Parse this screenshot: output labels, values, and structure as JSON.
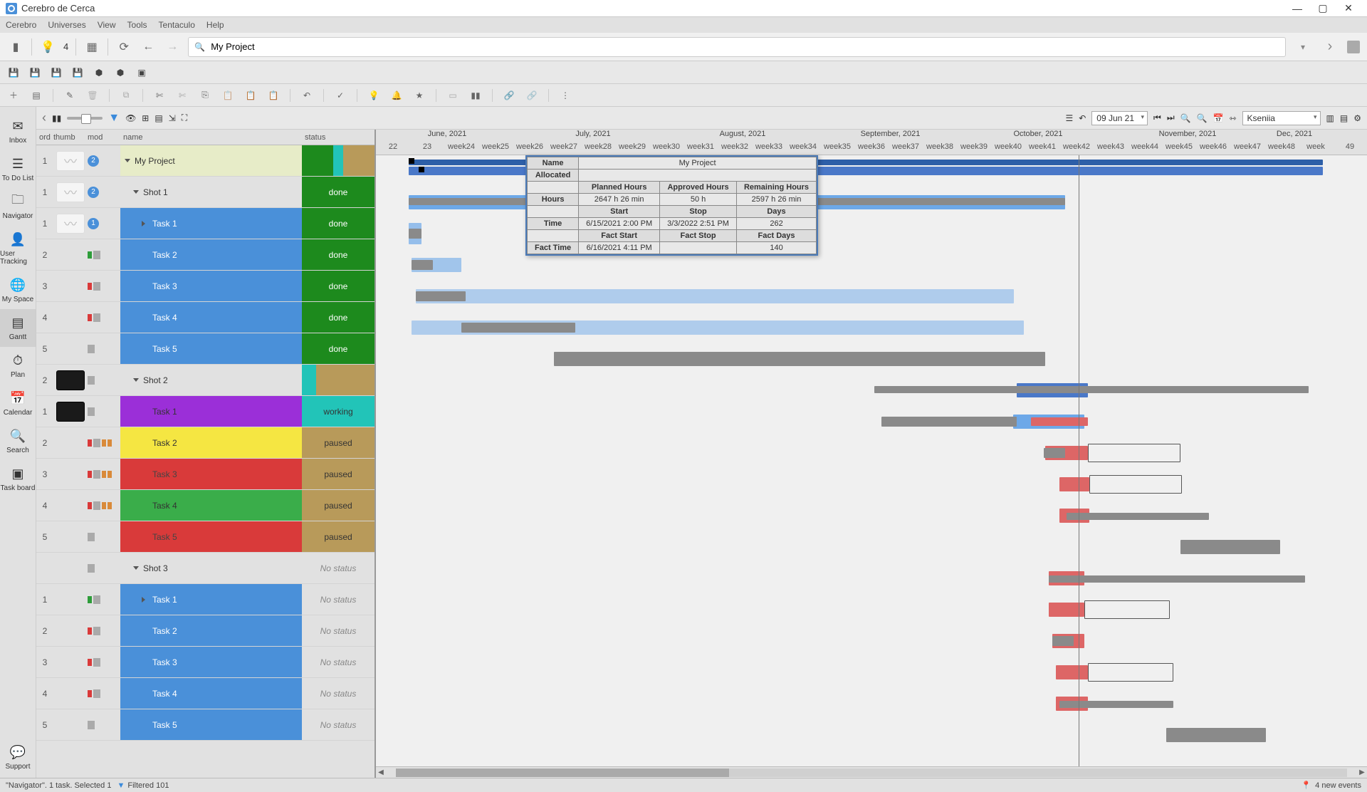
{
  "app": {
    "title": "Cerebro de Cerca"
  },
  "menus": [
    "Cerebro",
    "Universes",
    "View",
    "Tools",
    "Tentaculo",
    "Help"
  ],
  "search": {
    "value": "My Project",
    "lightbulb_count": "4"
  },
  "sidebar": [
    {
      "label": "Inbox"
    },
    {
      "label": "To Do List"
    },
    {
      "label": "Navigator"
    },
    {
      "label": "User Tracking"
    },
    {
      "label": "My Space"
    },
    {
      "label": "Gantt"
    },
    {
      "label": "Plan"
    },
    {
      "label": "Calendar"
    },
    {
      "label": "Search"
    },
    {
      "label": "Task board"
    }
  ],
  "support_label": "Support",
  "gantt_toolbar": {
    "date": "09 Jun 21",
    "user": "Kseniia"
  },
  "table_headers": {
    "ord": "ord",
    "thumb": "thumb",
    "mod": "mod",
    "name": "name",
    "status": "status"
  },
  "tasks": [
    {
      "ord": "1",
      "thumb": "leaf",
      "badge": "2",
      "name": "My Project",
      "level": 0,
      "nameClass": "project",
      "statusClass": "project",
      "statusText": ""
    },
    {
      "ord": "1",
      "thumb": "leaf",
      "badge": "2",
      "name": "Shot 1",
      "level": 1,
      "nameClass": "",
      "statusText": "done",
      "statusClass": "done"
    },
    {
      "ord": "1",
      "thumb": "leaf",
      "badge": "1",
      "mod": "blue",
      "name": "Task 1",
      "level": 2,
      "nameClass": "blue",
      "statusText": "done",
      "statusClass": "done"
    },
    {
      "ord": "2",
      "thumb": "",
      "mod": "green-grey",
      "name": "Task 2",
      "level": 2,
      "nameClass": "blue",
      "statusText": "done",
      "statusClass": "done"
    },
    {
      "ord": "3",
      "thumb": "",
      "mod": "red-grey",
      "name": "Task 3",
      "level": 2,
      "nameClass": "blue",
      "statusText": "done",
      "statusClass": "done"
    },
    {
      "ord": "4",
      "thumb": "",
      "mod": "red-grey",
      "name": "Task 4",
      "level": 2,
      "nameClass": "blue",
      "statusText": "done",
      "statusClass": "done"
    },
    {
      "ord": "5",
      "thumb": "",
      "mod": "grey",
      "name": "Task 5",
      "level": 2,
      "nameClass": "blue",
      "statusText": "done",
      "statusClass": "done"
    },
    {
      "ord": "2",
      "thumb": "dark",
      "mod": "grey",
      "name": "Shot 2",
      "level": 1,
      "nameClass": "",
      "statusClass": "shot2",
      "statusText": ""
    },
    {
      "ord": "1",
      "thumb": "dark",
      "mod": "grey",
      "name": "Task 1",
      "level": 2,
      "nameClass": "purple",
      "statusText": "working",
      "statusClass": "working"
    },
    {
      "ord": "2",
      "thumb": "",
      "mod": "red-grey-oo",
      "name": "Task 2",
      "level": 2,
      "nameClass": "yellow",
      "statusText": "paused",
      "statusClass": "paused"
    },
    {
      "ord": "3",
      "thumb": "",
      "mod": "red-grey-oo",
      "name": "Task 3",
      "level": 2,
      "nameClass": "red",
      "statusText": "paused",
      "statusClass": "paused"
    },
    {
      "ord": "4",
      "thumb": "",
      "mod": "red-grey-oo",
      "name": "Task 4",
      "level": 2,
      "nameClass": "green",
      "statusText": "paused",
      "statusClass": "paused"
    },
    {
      "ord": "5",
      "thumb": "",
      "mod": "grey",
      "name": "Task 5",
      "level": 2,
      "nameClass": "red",
      "statusText": "paused",
      "statusClass": "paused"
    },
    {
      "ord": "",
      "thumb": "",
      "mod": "grey",
      "name": "Shot 3",
      "level": 1,
      "nameClass": "",
      "statusText": "No status",
      "statusClass": "none"
    },
    {
      "ord": "1",
      "thumb": "",
      "mod": "green-grey",
      "name": "Task 1",
      "level": 2,
      "nameClass": "blue",
      "statusText": "No status",
      "statusClass": "none"
    },
    {
      "ord": "2",
      "thumb": "",
      "mod": "red-grey",
      "name": "Task 2",
      "level": 2,
      "nameClass": "blue",
      "statusText": "No status",
      "statusClass": "none"
    },
    {
      "ord": "3",
      "thumb": "",
      "mod": "red-grey",
      "name": "Task 3",
      "level": 2,
      "nameClass": "blue",
      "statusText": "No status",
      "statusClass": "none"
    },
    {
      "ord": "4",
      "thumb": "",
      "mod": "red-grey",
      "name": "Task 4",
      "level": 2,
      "nameClass": "blue",
      "statusText": "No status",
      "statusClass": "none"
    },
    {
      "ord": "5",
      "thumb": "",
      "mod": "grey",
      "name": "Task 5",
      "level": 2,
      "nameClass": "blue",
      "statusText": "No status",
      "statusClass": "none"
    }
  ],
  "gantt": {
    "months": [
      "June, 2021",
      "July, 2021",
      "August, 2021",
      "September, 2021",
      "October, 2021",
      "November, 2021",
      "Dec, 2021"
    ],
    "weeks": [
      "22",
      "23",
      "week24",
      "week25",
      "week26",
      "week27",
      "week28",
      "week29",
      "week30",
      "week31",
      "week32",
      "week33",
      "week34",
      "week35",
      "week36",
      "week37",
      "week38",
      "week39",
      "week40",
      "week41",
      "week42",
      "week43",
      "week44",
      "week45",
      "week46",
      "week47",
      "week48",
      "week",
      "49"
    ]
  },
  "tooltip": {
    "name_label": "Name",
    "name_value": "My Project",
    "allocated_label": "Allocated",
    "h_planned": "Planned Hours",
    "h_approved": "Approved Hours",
    "h_remaining": "Remaining Hours",
    "hours_label": "Hours",
    "hours_planned": "2647 h 26 min",
    "hours_approved": "50 h",
    "hours_remaining": "2597 h 26 min",
    "start_label": "Start",
    "stop_label": "Stop",
    "days_label": "Days",
    "time_label": "Time",
    "time_start": "6/15/2021 2:00 PM",
    "time_stop": "3/3/2022 2:51 PM",
    "time_days": "262",
    "fstart_label": "Fact Start",
    "fstop_label": "Fact Stop",
    "fdays_label": "Fact Days",
    "ftime_label": "Fact Time",
    "ftime_start": "6/16/2021 4:11 PM",
    "ftime_stop": "",
    "ftime_days": "140"
  },
  "statusbar": {
    "left": "\"Navigator\". 1 task. Selected 1",
    "filtered": "Filtered 101",
    "events": "4 new events"
  }
}
